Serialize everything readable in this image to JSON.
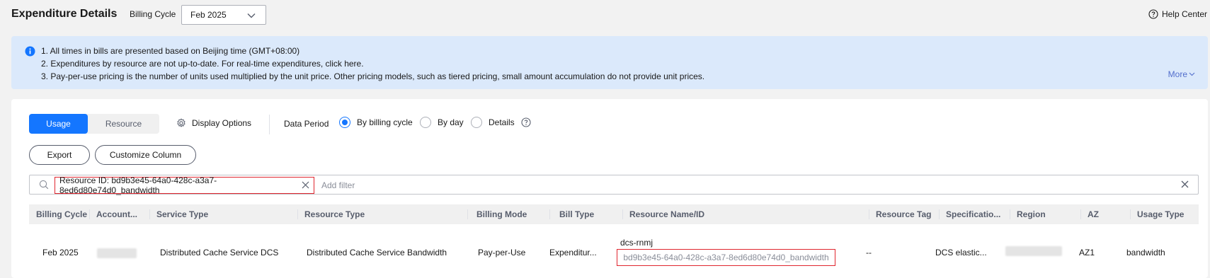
{
  "header": {
    "title": "Expenditure Details",
    "billing_cycle_label": "Billing Cycle",
    "billing_cycle_value": "Feb 2025",
    "help_label": "Help Center"
  },
  "notice": {
    "line1": "1. All times in bills are presented based on Beijing time (GMT+08:00)",
    "line2": "2. Expenditures by resource are not up-to-date. For real-time expenditures, click here.",
    "line3": "3. Pay-per-use pricing is the number of units used multiplied by the unit price. Other pricing models, such as tiered pricing, small amount accumulation do not provide unit prices.",
    "more_label": "More"
  },
  "tabs": {
    "usage": "Usage",
    "resource": "Resource"
  },
  "display_options_label": "Display Options",
  "data_period": {
    "label": "Data Period",
    "options": [
      "By billing cycle",
      "By day",
      "Details"
    ],
    "selected": "By billing cycle"
  },
  "buttons": {
    "export": "Export",
    "customize": "Customize Column"
  },
  "search": {
    "chip": "Resource ID: bd9b3e45-64a0-428c-a3a7-8ed6d80e74d0_bandwidth",
    "placeholder": "Add filter"
  },
  "table": {
    "columns": [
      "Billing Cycle",
      "Account...",
      "Service Type",
      "Resource Type",
      "Billing Mode",
      "Bill Type",
      "Resource Name/ID",
      "Resource Tag",
      "Specificatio...",
      "Region",
      "AZ",
      "Usage Type"
    ],
    "row": {
      "billing_cycle": "Feb 2025",
      "service_type": "Distributed Cache Service DCS",
      "resource_type": "Distributed Cache Service Bandwidth",
      "billing_mode": "Pay-per-Use",
      "bill_type": "Expenditur...",
      "resource_name": "dcs-rnmj",
      "resource_id": "bd9b3e45-64a0-428c-a3a7-8ed6d80e74d0_bandwidth",
      "resource_tag": "--",
      "specification": "DCS elastic...",
      "az": "AZ1",
      "usage_type": "bandwidth"
    }
  },
  "colors": {
    "accent": "#1476ff",
    "highlight_border": "#e0262f",
    "notice_bg": "#dbe9fb"
  }
}
